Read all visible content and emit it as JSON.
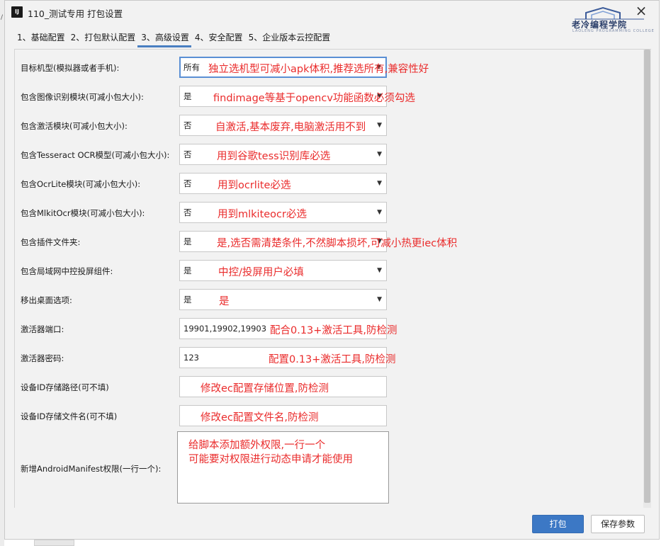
{
  "window": {
    "icon_text": "IJ",
    "title": "110_测试专用 打包设置"
  },
  "logo": {
    "text": "老冷编程学院",
    "subtext": "LAOLENG PROGRAMMING COLLEGE"
  },
  "tabs": [
    {
      "label": "1、基础配置"
    },
    {
      "label": "2、打包默认配置"
    },
    {
      "label": "3、高级设置",
      "active": true
    },
    {
      "label": "4、安全配置"
    },
    {
      "label": "5、企业版本云控配置"
    }
  ],
  "rows": [
    {
      "label": "目标机型(模拟器或者手机):",
      "value": "所有",
      "annotation": "独立选机型可减小apk体积,推荐选所有,兼容性好"
    },
    {
      "label": "包含图像识别模块(可减小包大小):",
      "value": "是",
      "annotation": "findimage等基于opencv功能函数必须勾选"
    },
    {
      "label": "包含激活模块(可减小包大小):",
      "value": "否",
      "annotation": "自激活,基本废弃,电脑激活用不到"
    },
    {
      "label": "包含Tesseract OCR模型(可减小包大小):",
      "value": "否",
      "annotation": "用到谷歌tess识别库必选"
    },
    {
      "label": "包含OcrLite模块(可减小包大小):",
      "value": "否",
      "annotation": "用到ocrlite必选"
    },
    {
      "label": "包含MlkitOcr模块(可减小包大小):",
      "value": "否",
      "annotation": "用到mlkiteocr必选"
    },
    {
      "label": "包含插件文件夹:",
      "value": "是",
      "annotation": "是,选否需清楚条件,不然脚本损坏,可减小热更iec体积"
    },
    {
      "label": "包含局域网中控投屏组件:",
      "value": "是",
      "annotation": "中控/投屏用户必填"
    },
    {
      "label": "移出桌面选项:",
      "value": "是",
      "annotation": "是"
    },
    {
      "label": "激活器端口:",
      "value": "19901,19902,19903",
      "annotation": "配合0.13+激活工具,防检测"
    },
    {
      "label": "激活器密码:",
      "value": "123",
      "annotation": "配置0.13+激活工具,防检测"
    },
    {
      "label": "设备ID存储路径(可不填)",
      "value": "",
      "annotation": "修改ec配置存储位置,防检测"
    },
    {
      "label": "设备ID存储文件名(可不填)",
      "value": "",
      "annotation": "修改ec配置文件名,防检测"
    }
  ],
  "manifest": {
    "label": "新增AndroidManifest权限(一行一个):",
    "annotation_line1": "给脚本添加额外权限,一行一个",
    "annotation_line2": "可能要对权限进行动态申请才能使用"
  },
  "buttons": {
    "pack": "打包",
    "save": "保存参数"
  },
  "colors": {
    "annotation": "#ea2b2b",
    "primary_button": "#3c78c5",
    "active_tab_underline": "#4a7fc1"
  }
}
